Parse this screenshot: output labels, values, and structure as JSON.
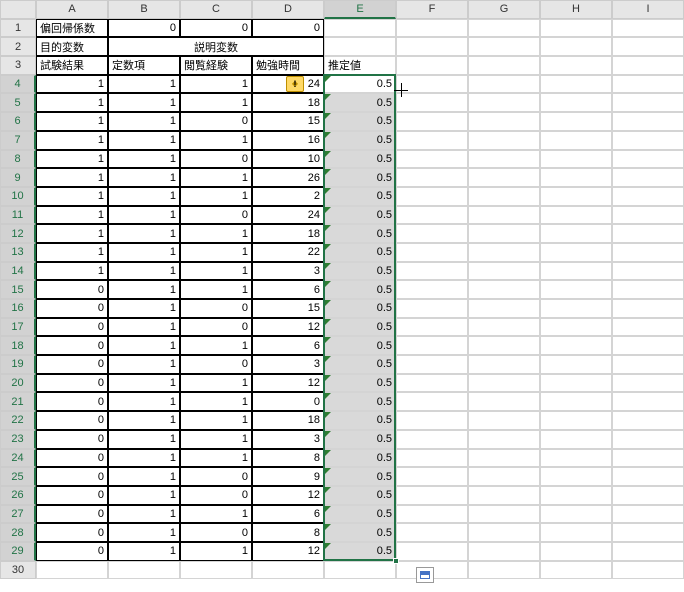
{
  "columns": [
    "A",
    "B",
    "C",
    "D",
    "E",
    "F",
    "G",
    "H",
    "I"
  ],
  "rowCount": 30,
  "selectedCol": "E",
  "selectedRows": [
    4,
    29
  ],
  "headers": {
    "A1": "偏回帰係数",
    "B1": "0",
    "C1": "0",
    "D1": "0",
    "A2": "目的変数",
    "BCD2": "説明変数",
    "A3": "試験結果",
    "B3": "定数項",
    "C3": "閲覧経験",
    "D3": "勉強時間",
    "E3": "推定値"
  },
  "data": [
    {
      "a": 1,
      "b": 1,
      "c": 1,
      "d": 24,
      "e": 0.5
    },
    {
      "a": 1,
      "b": 1,
      "c": 1,
      "d": 18,
      "e": 0.5
    },
    {
      "a": 1,
      "b": 1,
      "c": 0,
      "d": 15,
      "e": 0.5
    },
    {
      "a": 1,
      "b": 1,
      "c": 1,
      "d": 16,
      "e": 0.5
    },
    {
      "a": 1,
      "b": 1,
      "c": 0,
      "d": 10,
      "e": 0.5
    },
    {
      "a": 1,
      "b": 1,
      "c": 1,
      "d": 26,
      "e": 0.5
    },
    {
      "a": 1,
      "b": 1,
      "c": 1,
      "d": 2,
      "e": 0.5
    },
    {
      "a": 1,
      "b": 1,
      "c": 0,
      "d": 24,
      "e": 0.5
    },
    {
      "a": 1,
      "b": 1,
      "c": 1,
      "d": 18,
      "e": 0.5
    },
    {
      "a": 1,
      "b": 1,
      "c": 1,
      "d": 22,
      "e": 0.5
    },
    {
      "a": 1,
      "b": 1,
      "c": 1,
      "d": 3,
      "e": 0.5
    },
    {
      "a": 0,
      "b": 1,
      "c": 1,
      "d": 6,
      "e": 0.5
    },
    {
      "a": 0,
      "b": 1,
      "c": 0,
      "d": 15,
      "e": 0.5
    },
    {
      "a": 0,
      "b": 1,
      "c": 0,
      "d": 12,
      "e": 0.5
    },
    {
      "a": 0,
      "b": 1,
      "c": 1,
      "d": 6,
      "e": 0.5
    },
    {
      "a": 0,
      "b": 1,
      "c": 0,
      "d": 3,
      "e": 0.5
    },
    {
      "a": 0,
      "b": 1,
      "c": 1,
      "d": 12,
      "e": 0.5
    },
    {
      "a": 0,
      "b": 1,
      "c": 1,
      "d": 0,
      "e": 0.5
    },
    {
      "a": 0,
      "b": 1,
      "c": 1,
      "d": 18,
      "e": 0.5
    },
    {
      "a": 0,
      "b": 1,
      "c": 1,
      "d": 3,
      "e": 0.5
    },
    {
      "a": 0,
      "b": 1,
      "c": 1,
      "d": 8,
      "e": 0.5
    },
    {
      "a": 0,
      "b": 1,
      "c": 0,
      "d": 9,
      "e": 0.5
    },
    {
      "a": 0,
      "b": 1,
      "c": 0,
      "d": 12,
      "e": 0.5
    },
    {
      "a": 0,
      "b": 1,
      "c": 1,
      "d": 6,
      "e": 0.5
    },
    {
      "a": 0,
      "b": 1,
      "c": 0,
      "d": 8,
      "e": 0.5
    },
    {
      "a": 0,
      "b": 1,
      "c": 1,
      "d": 12,
      "e": 0.5
    }
  ],
  "icons": {
    "smartTag": "error-check-icon",
    "autofill": "autofill-options-icon"
  }
}
